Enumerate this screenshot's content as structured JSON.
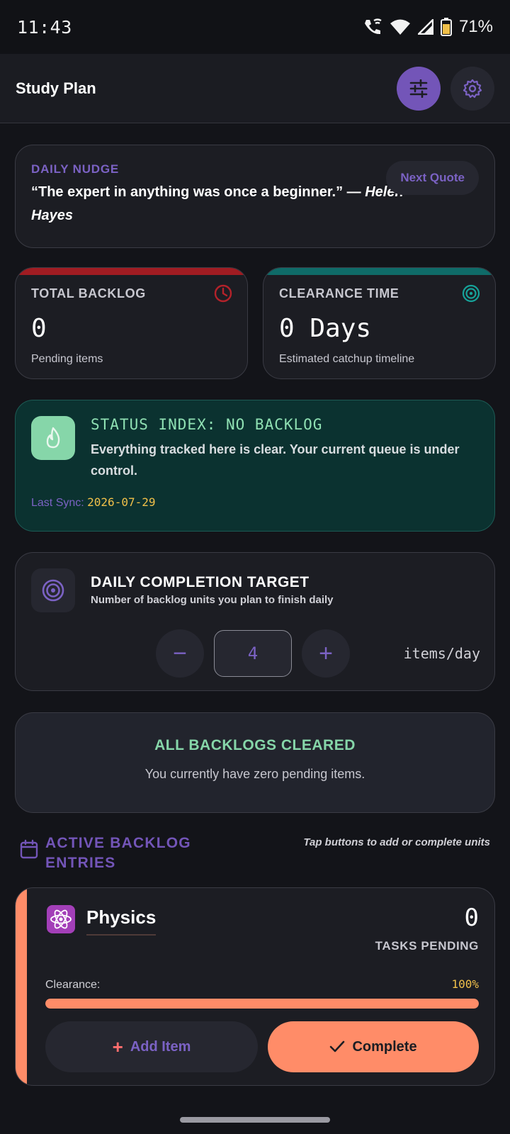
{
  "status_bar": {
    "time": "11:43",
    "battery": "71%"
  },
  "header": {
    "title": "Study Plan"
  },
  "nudge": {
    "label": "DAILY NUDGE",
    "quote": "“The expert in anything was once a beginner.” —",
    "author": "Helen Hayes",
    "next_label": "Next Quote"
  },
  "stats": {
    "backlog": {
      "label": "TOTAL BACKLOG",
      "value": "0",
      "sub": "Pending items",
      "color": "#a01c22"
    },
    "clearance": {
      "label": "CLEARANCE TIME",
      "value": "0 Days",
      "sub": "Estimated catchup timeline",
      "color": "#0f6b68"
    }
  },
  "status": {
    "head": "STATUS INDEX: NO BACKLOG",
    "desc": "Everything tracked here is clear. Your current queue is under control.",
    "sync_label": "Last Sync:",
    "sync_date": "2026-07-29"
  },
  "target": {
    "head": "DAILY COMPLETION TARGET",
    "sub": "Number of backlog units you plan to finish daily",
    "minus": "−",
    "value": "4",
    "plus": "+",
    "unit": "items/day"
  },
  "cleared": {
    "head": "ALL BACKLOGS CLEARED",
    "sub": "You currently have zero pending items."
  },
  "section": {
    "title": "ACTIVE BACKLOG ENTRIES",
    "hint": "Tap buttons to add or complete units"
  },
  "subject": {
    "name": "Physics",
    "count": "0",
    "pending_label": "TASKS PENDING",
    "clearance_label": "Clearance:",
    "percent_text": "100%",
    "progress": 1.0,
    "add_label": "Add Item",
    "complete_label": "Complete",
    "accent": "#ff8c68"
  },
  "icons": {
    "header_primary": "sliders-icon",
    "header_secondary": "gear-icon",
    "backlog": "clock-icon",
    "clearance": "target-icon",
    "status": "flame-icon",
    "target": "target-icon",
    "section": "calendar-icon",
    "subject": "atom-icon"
  }
}
